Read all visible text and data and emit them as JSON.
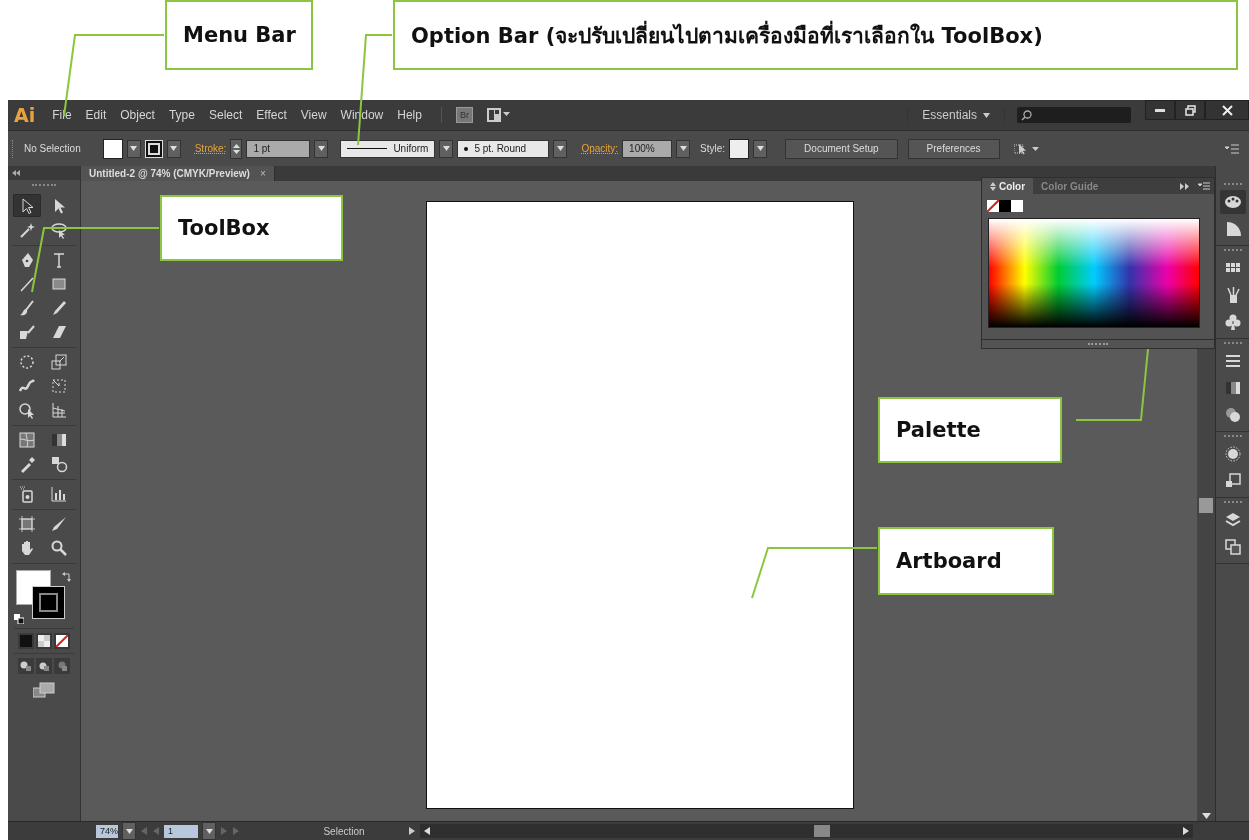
{
  "callouts": [
    {
      "label": "Menu Bar"
    },
    {
      "label": "Option Bar (จะปรับเปลี่ยนไปตามเครื่องมือที่เราเลือกใน ToolBox)"
    },
    {
      "label": "ToolBox"
    },
    {
      "label": "Palette"
    },
    {
      "label": "Artboard"
    }
  ],
  "menu_bar": {
    "logo": "Ai",
    "items": [
      "File",
      "Edit",
      "Object",
      "Type",
      "Select",
      "Effect",
      "View",
      "Window",
      "Help"
    ],
    "bridge": "Br",
    "workspace": "Essentials"
  },
  "option_bar": {
    "selection": "No Selection",
    "stroke_label": "Stroke:",
    "stroke_value": "1 pt",
    "profile": "Uniform",
    "brush": "5 pt. Round",
    "opacity_label": "Opacity:",
    "opacity_value": "100%",
    "style_label": "Style:",
    "buttons": [
      "Document Setup",
      "Preferences"
    ]
  },
  "document_tab": {
    "title": "Untitled-2 @ 74% (CMYK/Preview)",
    "close": "×"
  },
  "tool_groups": [
    [
      {
        "kind": "selection",
        "selected": true
      },
      {
        "kind": "direct-selection",
        "selected": false
      },
      {
        "kind": "magic-wand",
        "selected": false
      },
      {
        "kind": "lasso",
        "selected": false
      }
    ],
    [
      {
        "kind": "pen",
        "selected": false
      },
      {
        "kind": "type",
        "selected": false
      },
      {
        "kind": "line",
        "selected": false
      },
      {
        "kind": "rectangle",
        "selected": false
      },
      {
        "kind": "paintbrush",
        "selected": false
      },
      {
        "kind": "pencil",
        "selected": false
      },
      {
        "kind": "blob-brush",
        "selected": false
      },
      {
        "kind": "eraser",
        "selected": false
      }
    ],
    [
      {
        "kind": "rotate",
        "selected": false
      },
      {
        "kind": "scale",
        "selected": false
      },
      {
        "kind": "warp",
        "selected": false
      },
      {
        "kind": "free-transform",
        "selected": false
      },
      {
        "kind": "shape-builder",
        "selected": false
      },
      {
        "kind": "perspective-grid",
        "selected": false
      }
    ],
    [
      {
        "kind": "mesh",
        "selected": false
      },
      {
        "kind": "gradient",
        "selected": false
      },
      {
        "kind": "eyedropper",
        "selected": false
      },
      {
        "kind": "blend",
        "selected": false
      }
    ],
    [
      {
        "kind": "symbol-sprayer",
        "selected": false
      },
      {
        "kind": "column-graph",
        "selected": false
      }
    ],
    [
      {
        "kind": "artboard",
        "selected": false
      },
      {
        "kind": "slice",
        "selected": false
      },
      {
        "kind": "hand",
        "selected": false
      },
      {
        "kind": "zoom",
        "selected": false
      }
    ]
  ],
  "color_panel": {
    "tabs": [
      {
        "label": "Color",
        "selected": true
      },
      {
        "label": "Color Guide",
        "selected": false
      }
    ]
  },
  "dock_groups": [
    [
      {
        "kind": "color",
        "selected": true
      },
      {
        "kind": "color-guide",
        "selected": false
      }
    ],
    [
      {
        "kind": "swatches",
        "selected": false
      },
      {
        "kind": "brushes",
        "selected": false
      },
      {
        "kind": "symbols",
        "selected": false
      }
    ],
    [
      {
        "kind": "stroke",
        "selected": false
      },
      {
        "kind": "gradient",
        "selected": false
      },
      {
        "kind": "transparency",
        "selected": false
      }
    ],
    [
      {
        "kind": "appearance",
        "selected": false
      },
      {
        "kind": "graphic-styles",
        "selected": false
      }
    ],
    [
      {
        "kind": "layers",
        "selected": false
      },
      {
        "kind": "artboards",
        "selected": false
      }
    ]
  ],
  "status_bar": {
    "zoom": "74%",
    "page": "1",
    "tool": "Selection"
  }
}
